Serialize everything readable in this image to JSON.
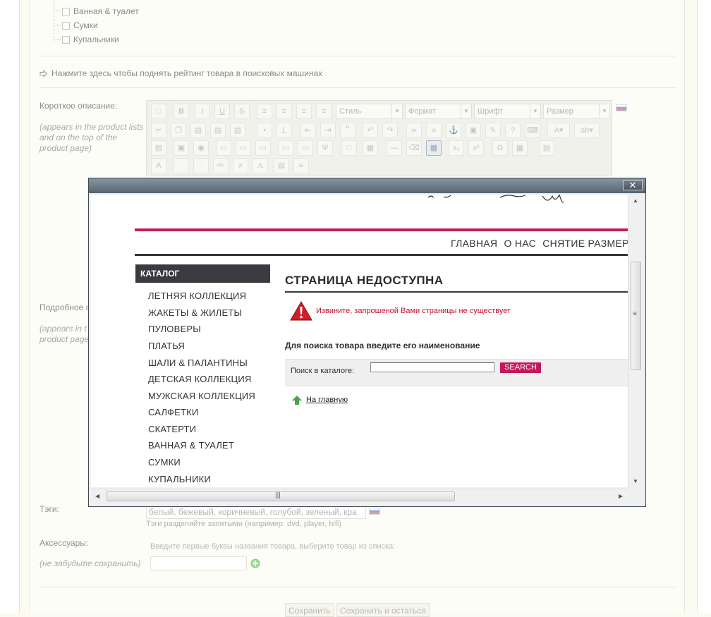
{
  "tree": {
    "items": [
      "Ванная & туалет",
      "Сумки",
      "Купальники"
    ]
  },
  "seo_link": "Нажмите здесь чтобы поднять рейтинг товара в поисковых машинах",
  "short_desc": {
    "label": "Короткое описание:",
    "hint": [
      "(appears in the product lists",
      "and on the top of the",
      "product page)"
    ]
  },
  "editor": {
    "style_label": "Стиль",
    "format_label": "Формат",
    "font_label": "Шрифт",
    "size_label": "Размер",
    "row1_icons": [
      "new-page-icon",
      "bold-icon",
      "italic-icon",
      "underline-icon",
      "strike-icon",
      "align-left-icon",
      "align-center-icon",
      "align-right-icon",
      "align-justify-icon"
    ],
    "row1_glyphs": [
      "",
      "B",
      "I",
      "U",
      "S",
      "≡",
      "≡",
      "≡",
      "≡"
    ]
  },
  "long_desc": {
    "label": "Подробное о",
    "hint": [
      "(appears in t",
      "product page"
    ]
  },
  "tags": {
    "label": "Тэги:",
    "value": "белый, бежевый, коричневый, голубой, зеленый, кра",
    "hint": "Тэги разделяйте запятыми (например: dvd, player, hifi)"
  },
  "accessories": {
    "label": "Аксессуары:",
    "hint": "Введите первые буквы названия товара, выберите товар из списка:",
    "note": "(не забудьте сохранить)"
  },
  "buttons": {
    "save": "Сохранить",
    "save_stay": "Сохранить и остаться"
  },
  "popup": {
    "close_glyph": "✕",
    "site": {
      "nav": [
        "ГЛАВНАЯ",
        "О НАС",
        "СНЯТИЕ РАЗМЕРО"
      ],
      "catalog_title": "КАТАЛОГ",
      "catalog_items": [
        "ЛЕТНЯЯ КОЛЛЕКЦИЯ",
        "ЖАКЕТЫ & ЖИЛЕТЫ",
        "ПУЛОВЕРЫ",
        "ПЛАТЬЯ",
        "ШАЛИ & ПАЛАНТИНЫ",
        "ДЕТСКАЯ КОЛЛЕКЦИЯ",
        "МУЖСКАЯ КОЛЛЕКЦИЯ",
        "САЛФЕТКИ",
        "СКАТЕРТИ",
        "ВАННАЯ & ТУАЛЕТ",
        "СУМКИ",
        "КУПАЛЬНИКИ"
      ],
      "error_title": "СТРАНИЦА НЕДОСТУПНА",
      "error_msg": "Извините, запрошеной Вами страницы не существует",
      "search_head": "Для поиска товара введите его наименование",
      "search_label": "Поиск в каталоге:",
      "search_button": "SEARCH",
      "home_link": "На главную"
    }
  },
  "colors": {
    "accent": "#c4185a",
    "error": "#c0102b",
    "catalog_bg": "#3a3a40"
  }
}
